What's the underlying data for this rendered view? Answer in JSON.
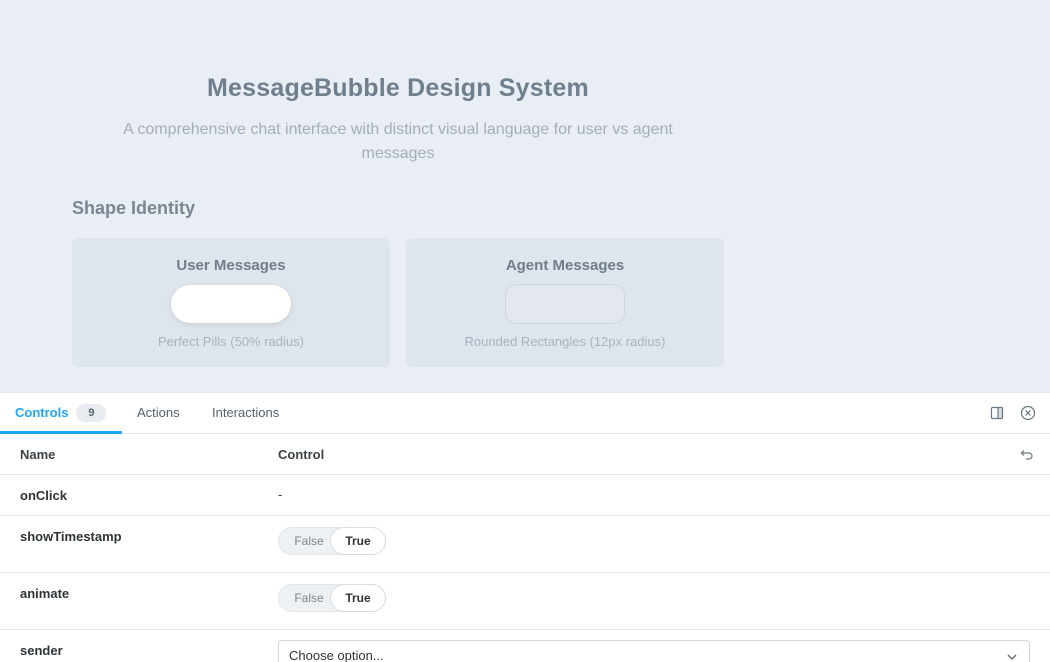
{
  "preview": {
    "title": "MessageBubble Design System",
    "subtitle": "A comprehensive chat interface with distinct visual language for user vs agent messages",
    "section_heading": "Shape Identity",
    "cards": [
      {
        "title": "User Messages",
        "caption": "Perfect Pills (50% radius)"
      },
      {
        "title": "Agent Messages",
        "caption": "Rounded Rectangles (12px radius)"
      }
    ]
  },
  "panel": {
    "tabs": [
      {
        "label": "Controls",
        "badge": "9"
      },
      {
        "label": "Actions"
      },
      {
        "label": "Interactions"
      }
    ],
    "icons": {
      "split": "split-panel-icon",
      "close": "close-circle-icon",
      "reset": "undo-icon"
    },
    "accent": "#1ea7fd",
    "table": {
      "headers": {
        "name": "Name",
        "control": "Control"
      },
      "rows": [
        {
          "name": "onClick",
          "control": "-"
        },
        {
          "name": "showTimestamp",
          "false_label": "False",
          "true_label": "True",
          "selected": "True"
        },
        {
          "name": "animate",
          "false_label": "False",
          "true_label": "True",
          "selected": "True"
        },
        {
          "name": "sender",
          "select_value": "Choose option..."
        }
      ]
    }
  }
}
